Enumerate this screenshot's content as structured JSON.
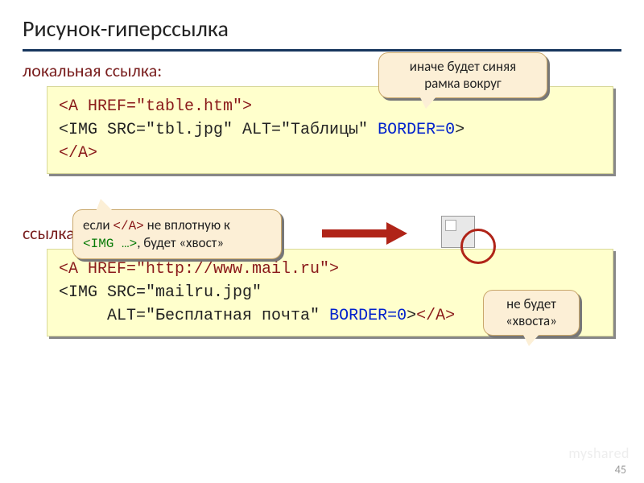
{
  "title": "Рисунок-гиперссылка",
  "section1": "локальная ссылка:",
  "section2": "ссылка на другой сервер:",
  "code1": {
    "a_open": "<A HREF=\"table.htm\">",
    "img": "<IMG SRC=\"tbl.jpg\" ALT=\"Таблицы\" ",
    "border": "BORDER=0",
    "img_close": ">",
    "a_close": "</A>"
  },
  "code2": {
    "a_open": "<A HREF=\"http://www.mail.ru\">",
    "img_l1": "<IMG SRC=\"mailru.jpg\"",
    "img_l2a": "     ALT=\"Бесплатная почта\" ",
    "border": "BORDER=0",
    "img_l2b": ">",
    "a_close": "</A>"
  },
  "callout_border": "иначе будет синяя\nрамка вокруг",
  "callout_tail": {
    "pre": "если ",
    "tag_close": "</A>",
    "mid": " не вплотную к ",
    "tag_img": "<IMG …>",
    "post": ", будет «хвост»"
  },
  "callout_tail2": "не будет\n«хвоста»",
  "page": "45",
  "watermark": "myshared"
}
